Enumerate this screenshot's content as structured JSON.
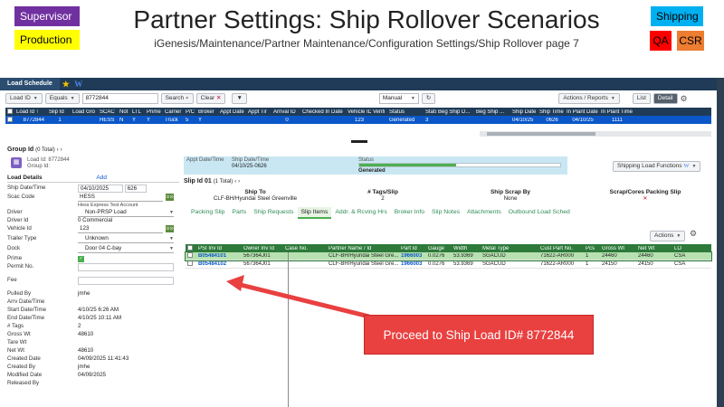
{
  "slide": {
    "title": "Partner Settings: Ship Rollover Scenarios",
    "subtitle": "iGenesis/Maintenance/Partner Maintenance/Configuration Settings/Ship Rollover page 7",
    "tags": {
      "supervisor": "Supervisor",
      "production": "Production",
      "shipping": "Shipping",
      "qa": "QA",
      "csr": "CSR"
    },
    "callout": "Proceed to Ship Load ID# 8772844"
  },
  "app": {
    "tab": "Load Schedule",
    "toolbar": {
      "field": "Load ID",
      "operator": "Equals",
      "value": "8772844",
      "search": "Search",
      "clear": "Clear",
      "clear_x": "✕",
      "mode": "Manual",
      "actions_reports": "Actions / Reports",
      "list": "List",
      "detail": "Detail"
    },
    "top_grid": {
      "columns": [
        "Load Id ↑",
        "Slip Id",
        "Load Gro",
        "SCAC",
        "Not",
        "LTL",
        "Prime",
        "Carrier",
        "P/C",
        "Broker",
        "Appt Date",
        "Appt Tir",
        "Arrival ID",
        "Checked In Date",
        "Vehicle ID",
        "Verifi",
        "Status",
        "Statu",
        "Beg Ship D...",
        "Beg Ship ...",
        "Ship Date",
        "Ship Time",
        "In Plant Date",
        "In Plant Time"
      ],
      "row": [
        "8772844",
        "1",
        "",
        "HESS",
        "N",
        "Y",
        "Y",
        "Truck",
        "5",
        "Y",
        "",
        "",
        "0",
        "",
        "123",
        "",
        "Generated",
        "3",
        "",
        "",
        "04/10/25",
        "0626",
        "04/10/25",
        "1111"
      ]
    },
    "group": {
      "label": "Group Id",
      "count": "(0 Total)",
      "load_id_line": "Load Id: 8772844",
      "group_id_line": "Group Id:"
    },
    "load_details": {
      "header": "Load Details",
      "add": "Add",
      "ship_date_label": "Ship Date/Time",
      "ship_date": "04/10/2025",
      "ship_time": "626",
      "scac_label": "Scac Code",
      "scac": "HESS",
      "scac_name": "Hess Express Test Account",
      "driver_label": "Driver",
      "driver": "Non-PRSP Load",
      "driver_id_label": "Driver Id",
      "driver_id": "0 Commercial",
      "vehicle_id_label": "Vehicle Id",
      "vehicle_id": "123",
      "trailer_type_label": "Trailer Type",
      "trailer_type": "Unknown",
      "dock_label": "Dock",
      "dock": "Door 04 C-bay",
      "prime_label": "Prime",
      "permit_label": "Permit No.",
      "fee_label": "Fee",
      "pulled_by_label": "Pulled By",
      "pulled_by": "jmhe",
      "arrv_label": "Arrv Date/Time",
      "start_label": "Start Date/Time",
      "start": "4/10/25 6:26 AM",
      "end_label": "End Date/Time",
      "end": "4/10/25 10:11 AM",
      "tags_label": "# Tags",
      "tags": "2",
      "gross_label": "Gross Wt",
      "gross": "48610",
      "tare_label": "Tare Wt",
      "net_label": "Net Wt",
      "net": "48610",
      "created_date_label": "Created Date",
      "created_date": "04/09/2025 11:41:43",
      "created_by_label": "Created By",
      "created_by": "jmhe",
      "modified_label": "Modified Date",
      "modified": "04/09/2025",
      "released_label": "Released By"
    },
    "status_card": {
      "appt_label": "Appt Date/Time",
      "ship_label": "Ship Date/Time",
      "ship_value": "04/10/25-0626",
      "status_label": "Status",
      "status_value": "Generated",
      "progress": 0.48
    },
    "ship_load_functions": "Shipping Load Functions",
    "slip": {
      "label": "Slip Id 01",
      "count": "(1 Total)",
      "ship_to_label": "Ship To",
      "ship_to": "CLF-BH/Hyundai Steel Greenville",
      "tags_slip_label": "# Tags/Slip",
      "tags_slip": "2",
      "scrap_label": "Ship Scrap By",
      "scrap": "None",
      "cores_label": "Scrap/Cores Packing Slip",
      "cores_value": "✕"
    },
    "tabs": [
      "Packing Slip",
      "Parts",
      "Ship Requests",
      "Slip Items",
      "Addr. & Rcving Hrs",
      "Broker Info",
      "Slip Notes",
      "Attachments",
      "Outbound Load Sched"
    ],
    "actions": "Actions",
    "slip_grid": {
      "columns": [
        "PSI Inv Id",
        "Owner Inv Id",
        "Case No.",
        "Partner Name / Id",
        "Part Id",
        "Gauge",
        "Width",
        "Metal Type",
        "Cust Part No.",
        "Pcs",
        "Gross Wt",
        "Net Wt",
        "LO"
      ],
      "rows": [
        [
          "B05484101",
          "567364J01",
          "",
          "CLF-BH/Hyundai Steel Gre...",
          "1966003",
          "0.0276",
          "53.9369",
          "SGACUD",
          "71622-AR000",
          "1",
          "24460",
          "24460",
          "CSA"
        ],
        [
          "B05484102",
          "567364J01",
          "",
          "CLF-BH/Hyundai Steel Gre...",
          "1966003",
          "0.0276",
          "53.9369",
          "SGACUD",
          "71622-AR000",
          "1",
          "24150",
          "24150",
          "CSA"
        ]
      ]
    }
  }
}
